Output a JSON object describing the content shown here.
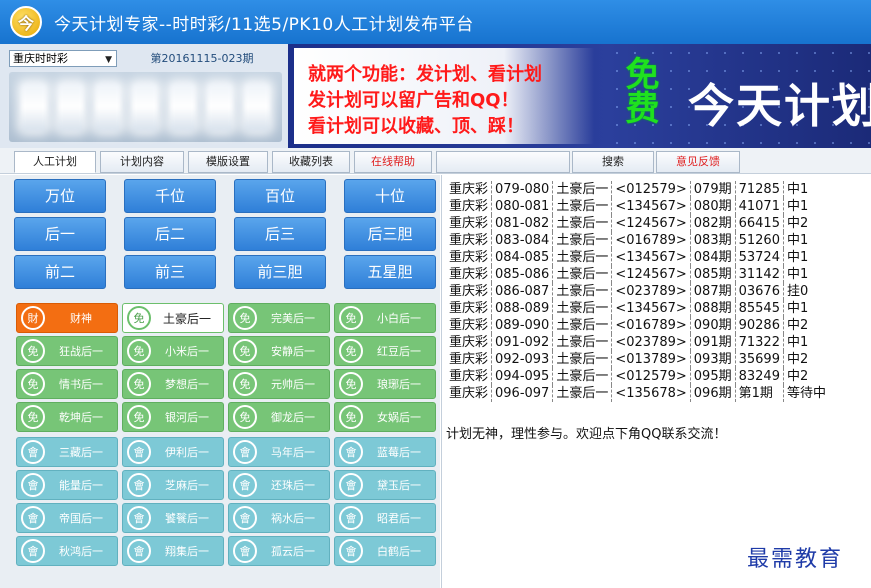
{
  "window": {
    "logo_glyph": "今",
    "title": "今天计划专家--时时彩/11选5/PK10人工计划发布平台"
  },
  "lottery": {
    "selected": "重庆时时彩",
    "period": "第20161115-023期"
  },
  "banner": {
    "line1": "就两个功能：发计划、看计划",
    "line2": "发计划可以留广告和QQ！",
    "line3": "看计划可以收藏、顶、踩！",
    "free": "免费",
    "brand": "今天计划"
  },
  "tabs": [
    {
      "label": "人工计划"
    },
    {
      "label": "计划内容"
    },
    {
      "label": "模版设置"
    },
    {
      "label": "收藏列表"
    },
    {
      "label": "在线帮助"
    },
    {
      "label": ""
    },
    {
      "label": "搜索"
    },
    {
      "label": "意见反馈"
    }
  ],
  "position_buttons": [
    {
      "label": "万位"
    },
    {
      "label": "千位"
    },
    {
      "label": "百位"
    },
    {
      "label": "十位"
    },
    {
      "label": "后一"
    },
    {
      "label": "后二"
    },
    {
      "label": "后三"
    },
    {
      "label": "后三胆"
    },
    {
      "label": "前二"
    },
    {
      "label": "前三"
    },
    {
      "label": "前三胆"
    },
    {
      "label": "五星胆"
    }
  ],
  "plans": [
    {
      "badge": "財",
      "label": "财神"
    },
    {
      "badge": "免",
      "label": "土豪后一"
    },
    {
      "badge": "免",
      "label": "完美后一"
    },
    {
      "badge": "免",
      "label": "小白后一"
    },
    {
      "badge": "免",
      "label": "狂战后一"
    },
    {
      "badge": "免",
      "label": "小米后一"
    },
    {
      "badge": "免",
      "label": "安静后一"
    },
    {
      "badge": "免",
      "label": "红豆后一"
    },
    {
      "badge": "免",
      "label": "情书后一"
    },
    {
      "badge": "免",
      "label": "梦想后一"
    },
    {
      "badge": "免",
      "label": "元帅后一"
    },
    {
      "badge": "免",
      "label": "琅琊后一"
    },
    {
      "badge": "免",
      "label": "乾坤后一"
    },
    {
      "badge": "免",
      "label": "银河后一"
    },
    {
      "badge": "免",
      "label": "御龙后一"
    },
    {
      "badge": "免",
      "label": "女娲后一"
    },
    {
      "badge": "會",
      "label": "三藏后一"
    },
    {
      "badge": "會",
      "label": "伊利后一"
    },
    {
      "badge": "會",
      "label": "马年后一"
    },
    {
      "badge": "會",
      "label": "蓝莓后一"
    },
    {
      "badge": "會",
      "label": "能量后一"
    },
    {
      "badge": "會",
      "label": "芝麻后一"
    },
    {
      "badge": "會",
      "label": "还珠后一"
    },
    {
      "badge": "會",
      "label": "黛玉后一"
    },
    {
      "badge": "會",
      "label": "帝国后一"
    },
    {
      "badge": "會",
      "label": "饕餮后一"
    },
    {
      "badge": "會",
      "label": "祸水后一"
    },
    {
      "badge": "會",
      "label": "昭君后一"
    },
    {
      "badge": "會",
      "label": "秋鸿后一"
    },
    {
      "badge": "會",
      "label": "翔集后一"
    },
    {
      "badge": "會",
      "label": "孤云后一"
    },
    {
      "badge": "會",
      "label": "白鹤后一"
    }
  ],
  "plan_rows": [
    [
      "重庆彩",
      "079-080",
      "土豪后一",
      "<012579>",
      "079期",
      "71285",
      "中1"
    ],
    [
      "重庆彩",
      "080-081",
      "土豪后一",
      "<134567>",
      "080期",
      "41071",
      "中1"
    ],
    [
      "重庆彩",
      "081-082",
      "土豪后一",
      "<124567>",
      "082期",
      "66415",
      "中2"
    ],
    [
      "重庆彩",
      "083-084",
      "土豪后一",
      "<016789>",
      "083期",
      "51260",
      "中1"
    ],
    [
      "重庆彩",
      "084-085",
      "土豪后一",
      "<134567>",
      "084期",
      "53724",
      "中1"
    ],
    [
      "重庆彩",
      "085-086",
      "土豪后一",
      "<124567>",
      "085期",
      "31142",
      "中1"
    ],
    [
      "重庆彩",
      "086-087",
      "土豪后一",
      "<023789>",
      "087期",
      "03676",
      "挂0"
    ],
    [
      "重庆彩",
      "088-089",
      "土豪后一",
      "<134567>",
      "088期",
      "85545",
      "中1"
    ],
    [
      "重庆彩",
      "089-090",
      "土豪后一",
      "<016789>",
      "090期",
      "90286",
      "中2"
    ],
    [
      "重庆彩",
      "091-092",
      "土豪后一",
      "<023789>",
      "091期",
      "71322",
      "中1"
    ],
    [
      "重庆彩",
      "092-093",
      "土豪后一",
      "<013789>",
      "093期",
      "35699",
      "中2"
    ],
    [
      "重庆彩",
      "094-095",
      "土豪后一",
      "<012579>",
      "095期",
      "83249",
      "中2"
    ],
    [
      "重庆彩",
      "096-097",
      "土豪后一",
      "<135678>",
      "096期",
      "第1期",
      "等待中"
    ]
  ],
  "notice": "计划无神，理性参与。欢迎点下角QQ联系交流！",
  "watermark": "最需教育"
}
